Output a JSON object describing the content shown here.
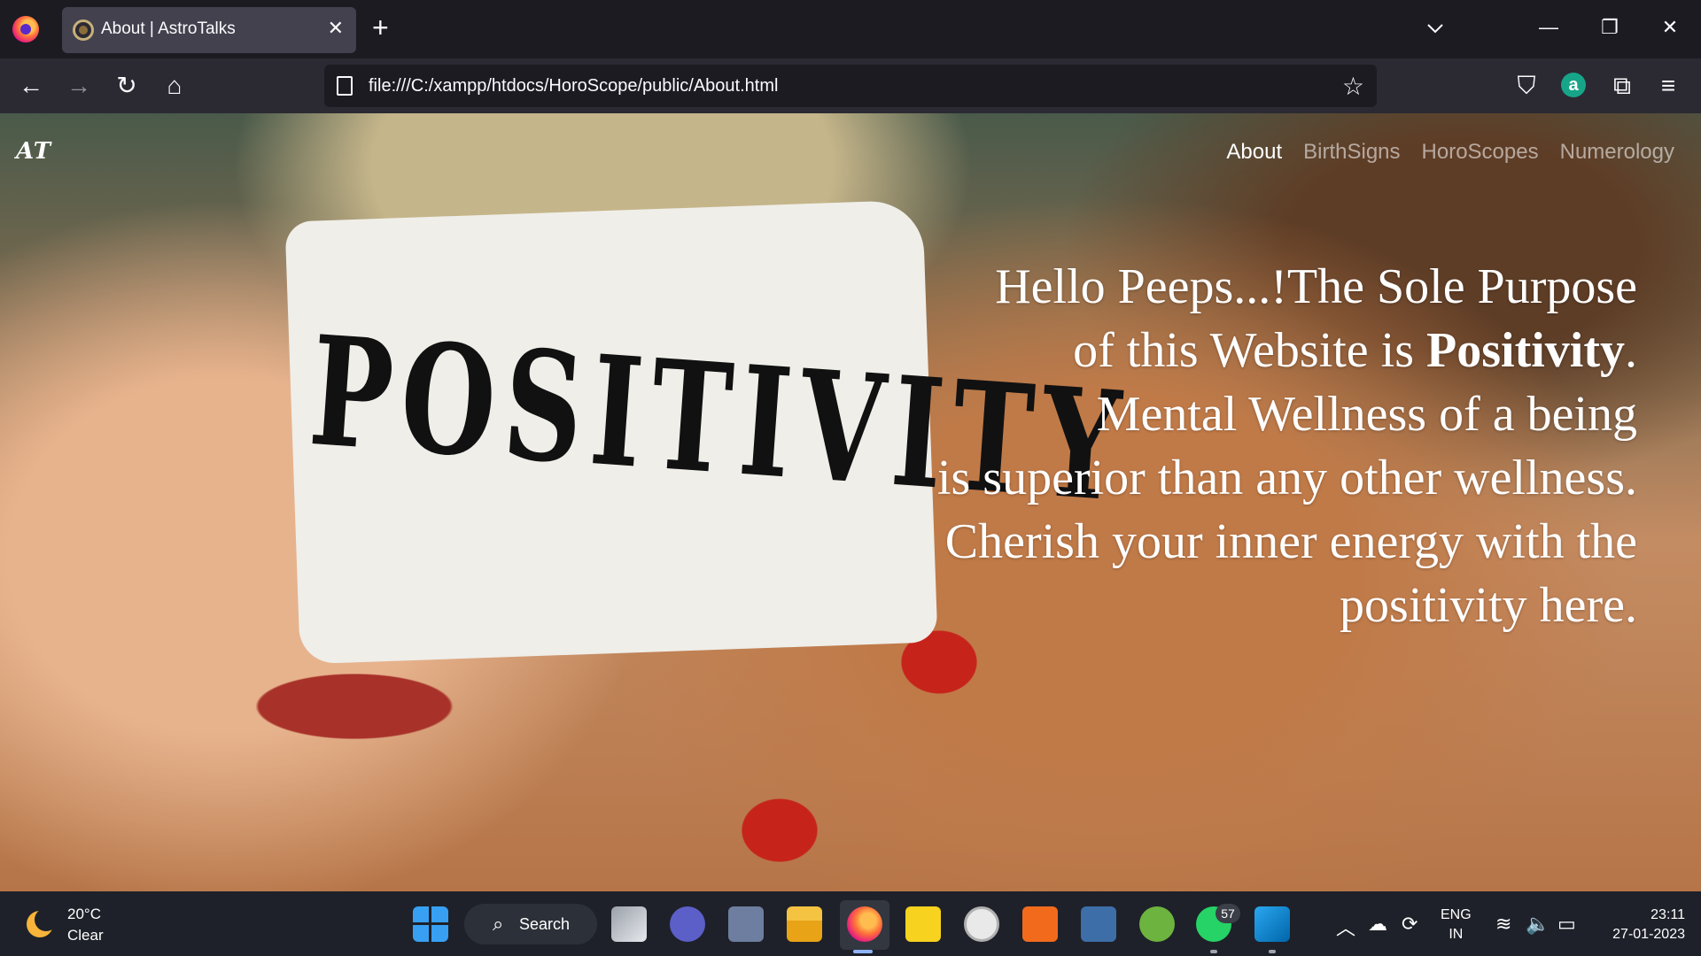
{
  "browser": {
    "tab_title": "About | AstroTalks",
    "tab_close": "✕",
    "new_tab": "+",
    "url": "file:///C:/xampp/htdocs/HoroScope/public/About.html",
    "window_controls": {
      "minimize": "—",
      "restore": "❐",
      "close": "✕"
    },
    "nav_icons": {
      "back": "←",
      "forward": "→",
      "reload": "↻",
      "home": "⌂",
      "star": "☆",
      "pocket": "⛉",
      "extensions": "⧉",
      "menu": "≡",
      "tab_list": "⌄"
    },
    "account_badge": "a"
  },
  "page": {
    "brand": "AT",
    "nav": [
      {
        "label": "About"
      },
      {
        "label": "BirthSigns"
      },
      {
        "label": "HoroScopes"
      },
      {
        "label": "Numerology"
      }
    ],
    "hero": {
      "line1": "Hello Peeps...!The Sole Purpose",
      "line2_pre": "of this Website is ",
      "line2_bold": "Positivity",
      "line2_post": ".",
      "line3": "Mental Wellness of a being",
      "line4": "is superior than any other wellness.",
      "line5": "Cherish your inner energy with the",
      "line6": "positivity here."
    },
    "image_label_text": "POSITIVITY"
  },
  "taskbar": {
    "weather": {
      "temp": "20°C",
      "condition": "Clear"
    },
    "search_label": "Search",
    "whatsapp_badge": "57",
    "language": {
      "line1": "ENG",
      "line2": "IN"
    },
    "clock": {
      "time": "23:11",
      "date": "27-01-2023"
    },
    "colors": {
      "accent": "#38a0f2",
      "background": "#1e2129"
    }
  }
}
